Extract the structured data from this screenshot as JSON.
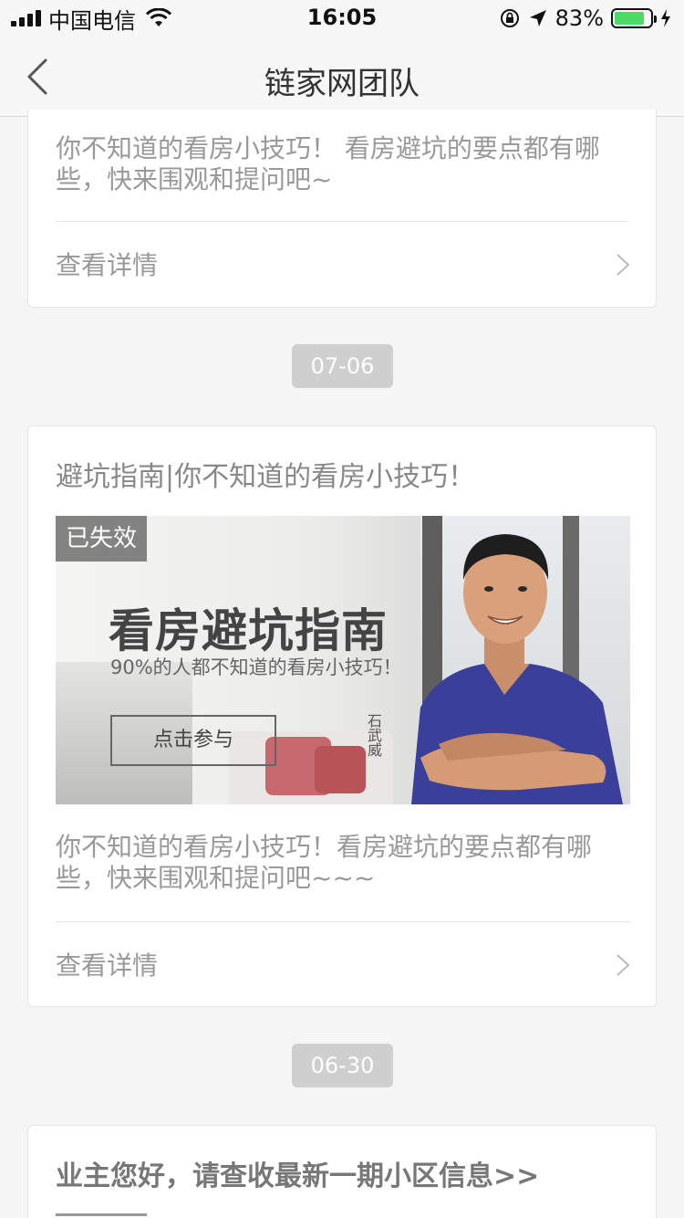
{
  "status_bar": {
    "carrier": "中国电信",
    "time": "16:05",
    "battery": "83%",
    "battery_level": 0.83
  },
  "nav": {
    "title": "链家网团队"
  },
  "cards": [
    {
      "text": "你不知道的看房小技巧！ 看房避坑的要点都有哪些，快来围观和提问吧~",
      "detail_label": "查看详情"
    },
    {
      "date": "07-06",
      "title": "避坑指南|你不知道的看房小技巧！",
      "expired_badge": "已失效",
      "banner": {
        "title": "看房避坑指南",
        "subtitle": "90%的人都不知道的看房小技巧！",
        "button": "点击参与",
        "name": "石武威"
      },
      "text": "你不知道的看房小技巧！看房避坑的要点都有哪些，快来围观和提问吧~~~",
      "detail_label": "查看详情"
    },
    {
      "date": "06-30",
      "title": "业主您好，请查收最新一期小区信息>>"
    }
  ]
}
